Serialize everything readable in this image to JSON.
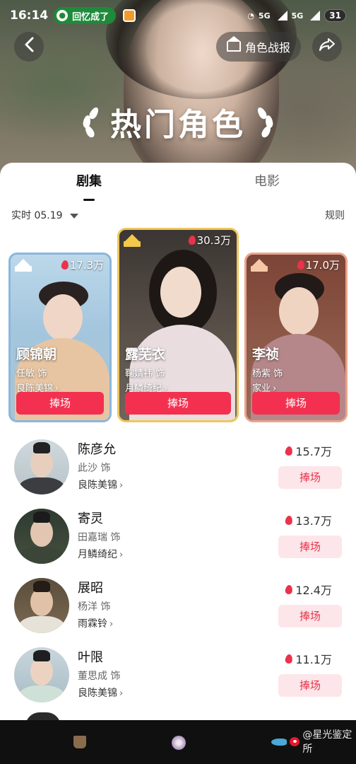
{
  "status_bar": {
    "time": "16:14",
    "notification": "回忆成了",
    "network_1": "5G",
    "network_2": "5G",
    "battery": "31"
  },
  "header": {
    "back_icon": "back-arrow-icon",
    "report_label": "角色战报",
    "share_icon": "share-icon",
    "title": "热门角色"
  },
  "tabs": [
    {
      "label": "剧集",
      "active": true
    },
    {
      "label": "电影",
      "active": false
    }
  ],
  "filter": {
    "label": "实时 05.19",
    "rules_label": "规则"
  },
  "podium": [
    {
      "rank": 2,
      "name": "顾锦朝",
      "actor": "任敏 饰",
      "drama": "良陈美锦",
      "heat": "17.3万",
      "cheer": "捧场",
      "crown_color": "#ffffff"
    },
    {
      "rank": 1,
      "name": "露芜衣",
      "actor": "鞠婧祎 饰",
      "drama": "月鳞绮纪",
      "heat": "30.3万",
      "cheer": "捧场",
      "crown_color": "#f4c84a"
    },
    {
      "rank": 3,
      "name": "李祯",
      "actor": "杨紫 饰",
      "drama": "家业",
      "heat": "17.0万",
      "cheer": "捧场",
      "crown_color": "#f7c6a8"
    }
  ],
  "rank_list": [
    {
      "name": "陈彦允",
      "actor": "此沙 饰",
      "drama": "良陈美锦",
      "heat": "15.7万",
      "cheer": "捧场"
    },
    {
      "name": "寄灵",
      "actor": "田嘉瑞 饰",
      "drama": "月鳞绮纪",
      "heat": "13.7万",
      "cheer": "捧场"
    },
    {
      "name": "展昭",
      "actor": "杨洋 饰",
      "drama": "雨霖铃",
      "heat": "12.4万",
      "cheer": "捧场"
    },
    {
      "name": "叶限",
      "actor": "董思成 饰",
      "drama": "良陈美锦",
      "heat": "11.1万",
      "cheer": "捧场"
    }
  ],
  "watermark": "@星光鉴定所",
  "colors": {
    "accent": "#f3304f",
    "accent_light": "#fde6ea",
    "gold": "#efc65d",
    "silver": "#8ab7de",
    "bronze": "#e7a48b"
  }
}
